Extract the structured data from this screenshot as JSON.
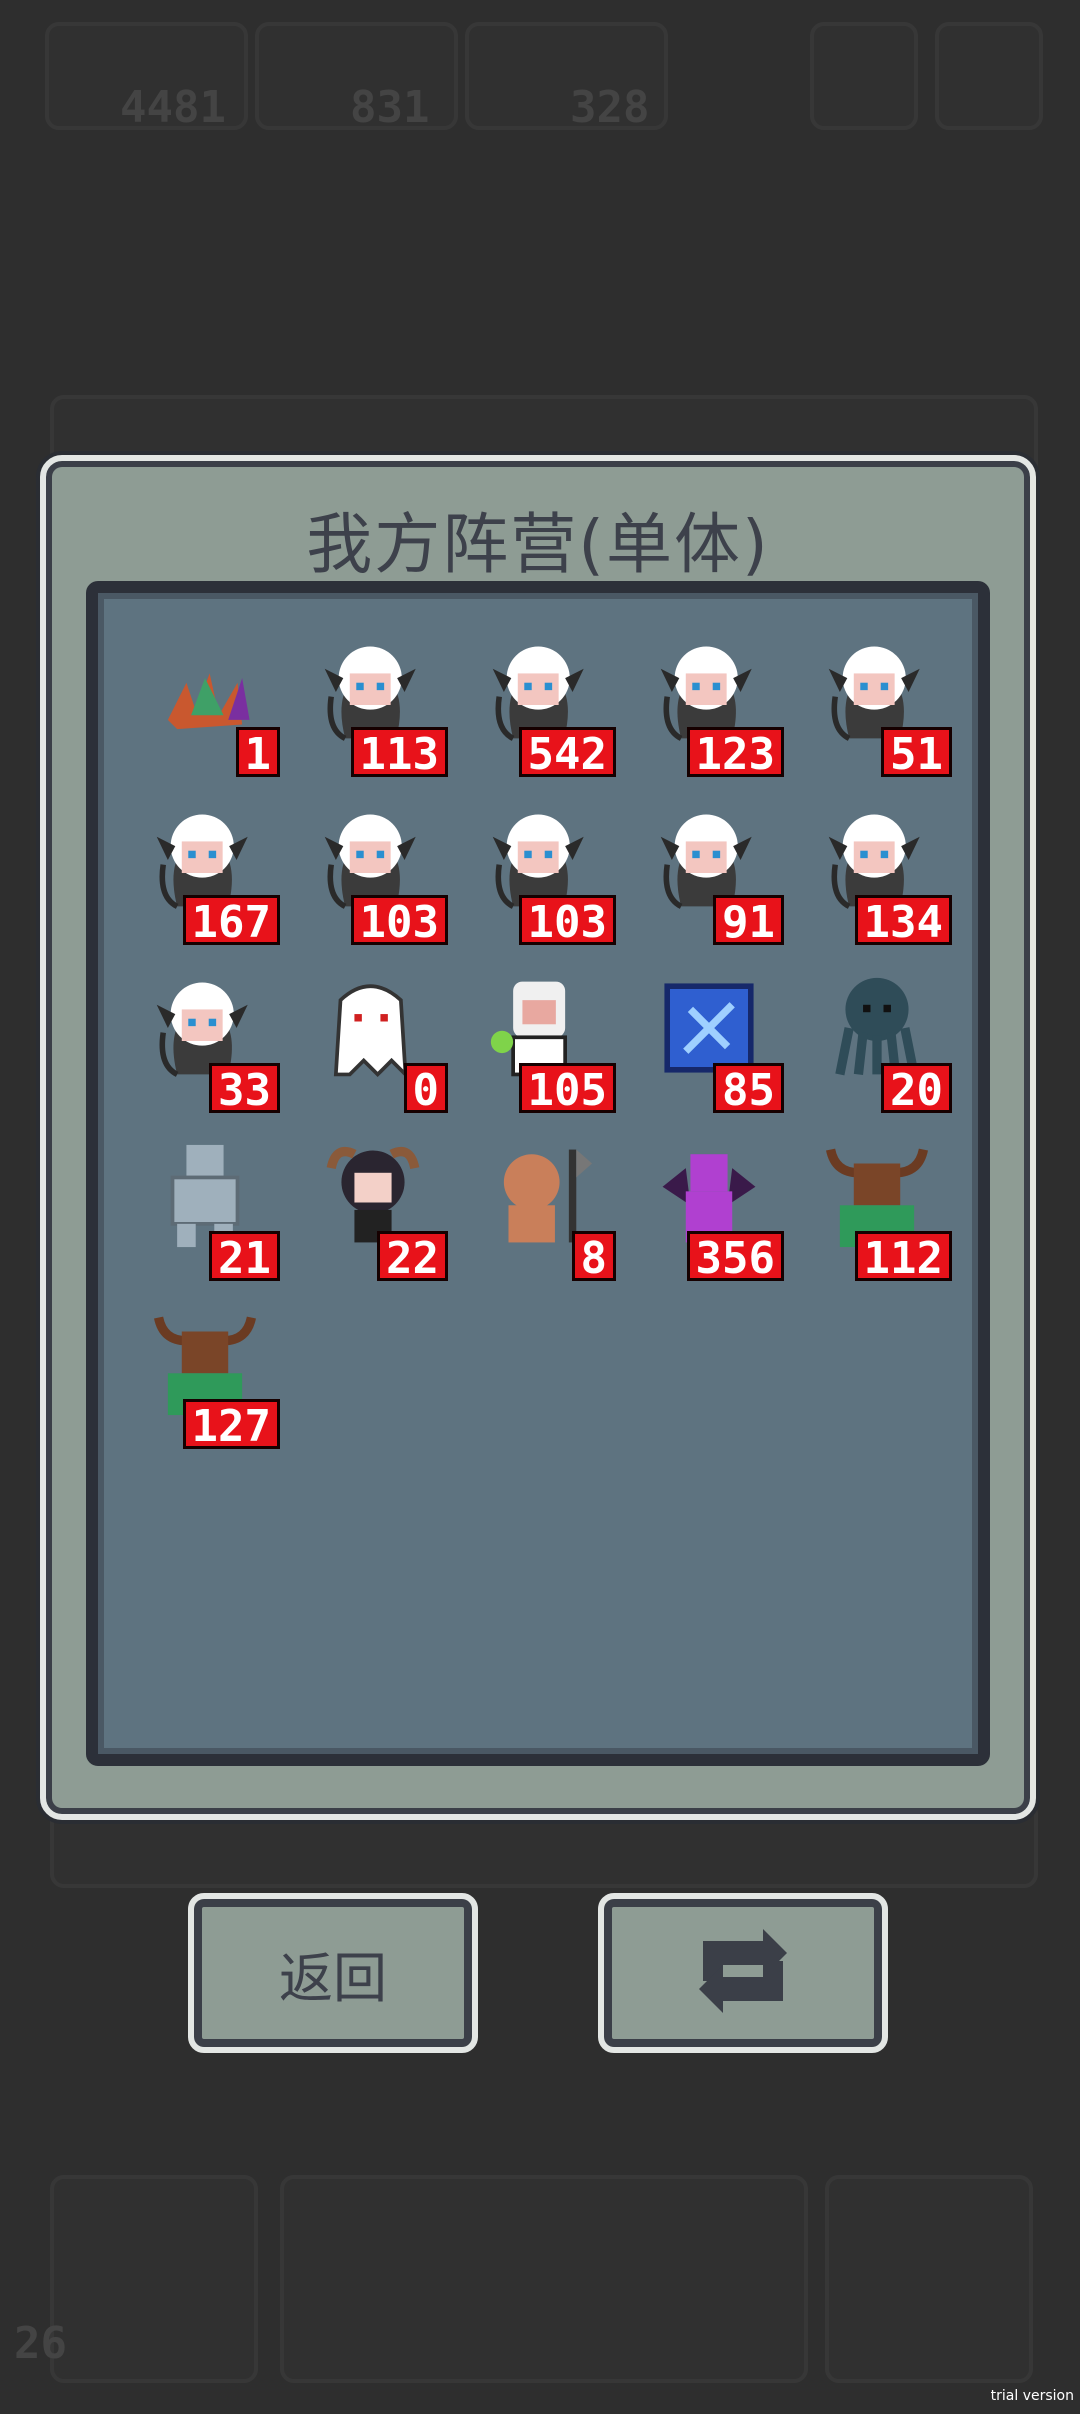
{
  "hud": {
    "counters": [
      "4481",
      "831",
      "328"
    ],
    "turn": "26"
  },
  "dialog": {
    "title": "我方阵营(单体)"
  },
  "units": [
    {
      "sprite": "crystal-plant-icon",
      "count": "1"
    },
    {
      "sprite": "white-hair-sorceress-icon",
      "count": "113"
    },
    {
      "sprite": "white-hair-sorceress-icon",
      "count": "542"
    },
    {
      "sprite": "white-hair-sorceress-icon",
      "count": "123"
    },
    {
      "sprite": "white-hair-sorceress-icon",
      "count": "51"
    },
    {
      "sprite": "white-hair-sorceress-icon",
      "count": "167"
    },
    {
      "sprite": "white-hair-sorceress-icon",
      "count": "103"
    },
    {
      "sprite": "white-hair-sorceress-icon",
      "count": "103"
    },
    {
      "sprite": "white-hair-sorceress-icon",
      "count": "91"
    },
    {
      "sprite": "white-hair-sorceress-icon",
      "count": "134"
    },
    {
      "sprite": "white-hair-sorceress-icon",
      "count": "33"
    },
    {
      "sprite": "white-ghost-icon",
      "count": "0"
    },
    {
      "sprite": "mummy-mage-icon",
      "count": "105"
    },
    {
      "sprite": "blue-crate-icon",
      "count": "85"
    },
    {
      "sprite": "dark-octopus-icon",
      "count": "20"
    },
    {
      "sprite": "stone-golem-icon",
      "count": "21"
    },
    {
      "sprite": "horned-girl-icon",
      "count": "22"
    },
    {
      "sprite": "axe-ogre-icon",
      "count": "8"
    },
    {
      "sprite": "purple-dragon-icon",
      "count": "356"
    },
    {
      "sprite": "green-minotaur-icon",
      "count": "112"
    },
    {
      "sprite": "green-minotaur-icon",
      "count": "127"
    }
  ],
  "buttons": {
    "back_label": "返回",
    "refresh_icon": "swap-arrows-icon"
  },
  "watermark": "trial version",
  "colors": {
    "count_badge": "#e8121a",
    "panel": "#8e9c94",
    "inner_panel": "#5e7380",
    "background": "#2e2e2e"
  }
}
